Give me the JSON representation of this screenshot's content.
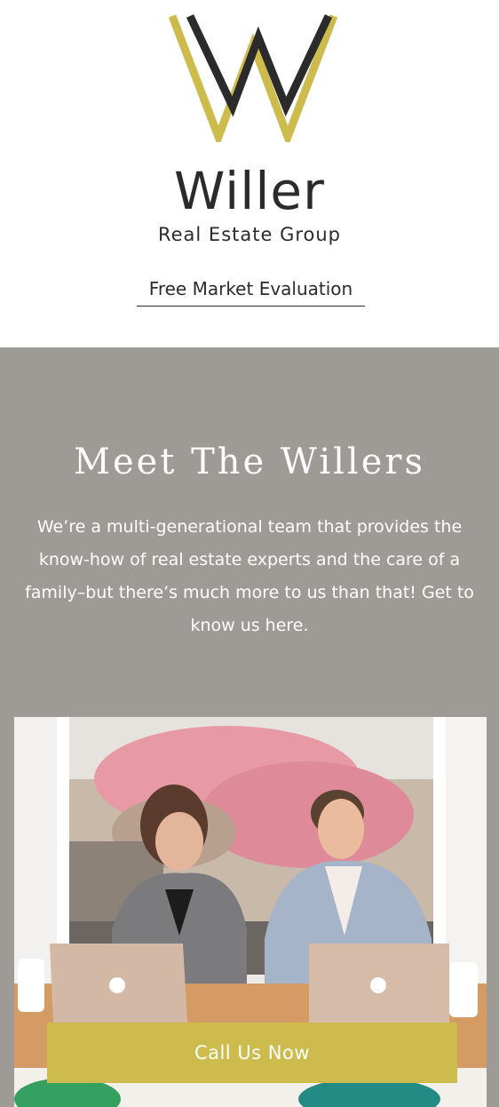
{
  "header": {
    "brand_name": "Willer",
    "brand_sub": "Real Estate Group",
    "eval_link": "Free Market Evaluation",
    "logo_icon": "willer-w-monogram-icon",
    "colors": {
      "gold": "#cdbb4d",
      "dark": "#2b2b2b"
    }
  },
  "meet": {
    "title": "Meet The Willers",
    "body": "We’re a multi-generational team that provides the know-how of real estate experts and the care of a family–but there’s much more to us than that! Get to know us here.",
    "background": "#9e9a95",
    "photo_alt": "team-photo"
  },
  "cta": {
    "label": "Call Us Now",
    "color": "#cdbb4d"
  }
}
